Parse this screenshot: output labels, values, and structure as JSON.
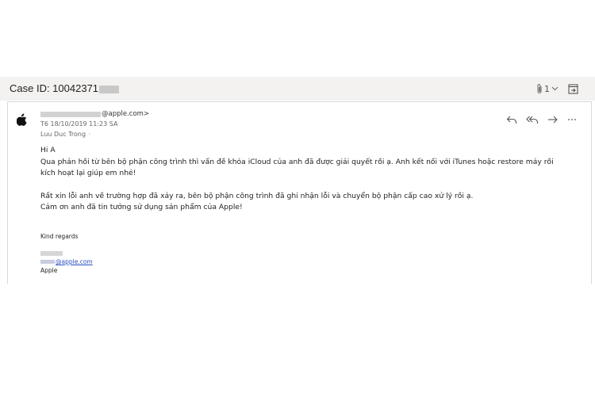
{
  "case": {
    "title": "Case ID: 10042371",
    "attachment_count": "1"
  },
  "message": {
    "from_email_suffix": "@apple.com>",
    "date": "T6 18/10/2019 11:23 SA",
    "to": "Luu Duc Trong",
    "body": {
      "greeting": "Hi A",
      "line1": "Qua phản hồi từ bên bộ phận công trình thì vấn đề khóa iCloud của anh đã được giải quyết rồi ạ. Anh kết nối với iTunes hoặc restore máy rồi",
      "line2": "kích hoạt lại giúp em nhé!",
      "line3": "Rất xin lỗi anh về trường hợp đã xảy ra, bên bộ phận công trình đã ghi nhận lỗi và chuyển bộ phận cấp cao xử lý rồi ạ.",
      "line4": "Cảm ơn anh đã tin tưởng sử dụng sản phẩm của Apple!"
    },
    "signature": {
      "regards": "Kind regards",
      "email_suffix": "@apple.com",
      "company": "Apple"
    }
  },
  "icons": {
    "sender_avatar": "apple-logo-icon",
    "attachment": "paperclip-icon",
    "expand": "open-in-window-icon",
    "actions": [
      "reply-icon",
      "reply-all-icon",
      "forward-icon",
      "more-icon"
    ]
  }
}
